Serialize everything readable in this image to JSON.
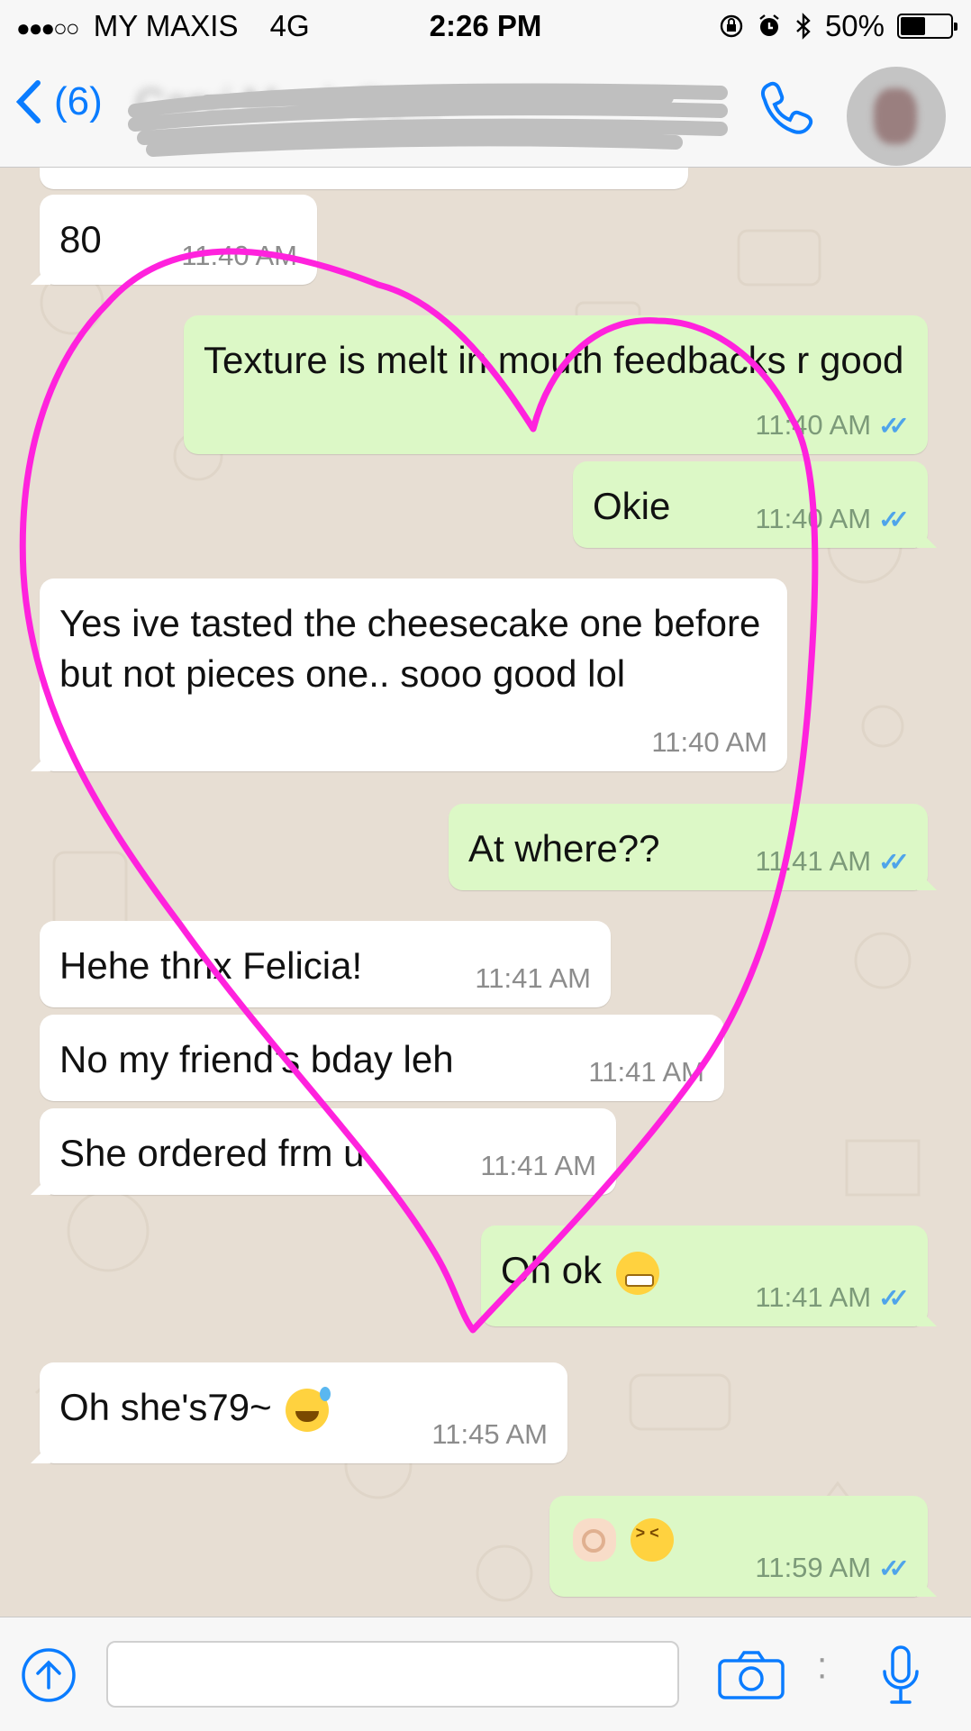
{
  "status_bar": {
    "signal": "●●●○○",
    "carrier": "MY MAXIS",
    "network": "4G",
    "time": "2:26 PM",
    "battery": "50%",
    "battery_level": 0.5,
    "icons": [
      "rotation-lock-icon",
      "alarm-icon",
      "bluetooth-icon"
    ]
  },
  "header": {
    "back_count": "(6)",
    "contact_name": "Carvi M... k So...",
    "call_icon": "phone-icon",
    "avatar": "contact-avatar"
  },
  "messages": [
    {
      "dir": "in",
      "text": "80",
      "time": "11:40 AM",
      "read": false
    },
    {
      "dir": "out",
      "text": "Texture is melt in mouth feedbacks r good",
      "time": "11:40 AM",
      "read": true
    },
    {
      "dir": "out",
      "text": "Okie",
      "time": "11:40 AM",
      "read": true
    },
    {
      "dir": "in",
      "text": "Yes ive tasted the cheesecake one before but not pieces one.. sooo good lol",
      "time": "11:40 AM",
      "read": false
    },
    {
      "dir": "out",
      "text": "At where??",
      "time": "11:41 AM",
      "read": true
    },
    {
      "dir": "in",
      "text": "Hehe thnx Felicia!",
      "time": "11:41 AM",
      "read": false
    },
    {
      "dir": "in",
      "text": "No my friend's bday leh",
      "time": "11:41 AM",
      "read": false
    },
    {
      "dir": "in",
      "text": "She ordered frm u",
      "time": "11:41 AM",
      "read": false
    },
    {
      "dir": "out",
      "text": "Oh ok",
      "emoji": "grimacing-face",
      "time": "11:41 AM",
      "read": true
    },
    {
      "dir": "in",
      "text": "Oh she's79~",
      "emoji": "sweat-smile-face",
      "time": "11:45 AM",
      "read": false
    },
    {
      "dir": "out",
      "text": "",
      "emoji": "ok-hand + laughing-face",
      "time": "11:59 AM",
      "read": true
    }
  ],
  "input_bar": {
    "placeholder": "",
    "icons": [
      "upload-icon",
      "camera-icon",
      "more-icon",
      "microphone-icon"
    ]
  },
  "colors": {
    "ios_blue": "#0a7cff",
    "outgoing_bubble": "#dcf8c6",
    "incoming_bubble": "#ffffff",
    "chat_background": "#e7ded3",
    "read_ticks": "#4fa4ea",
    "heart_annotation": "#ff22dd"
  }
}
